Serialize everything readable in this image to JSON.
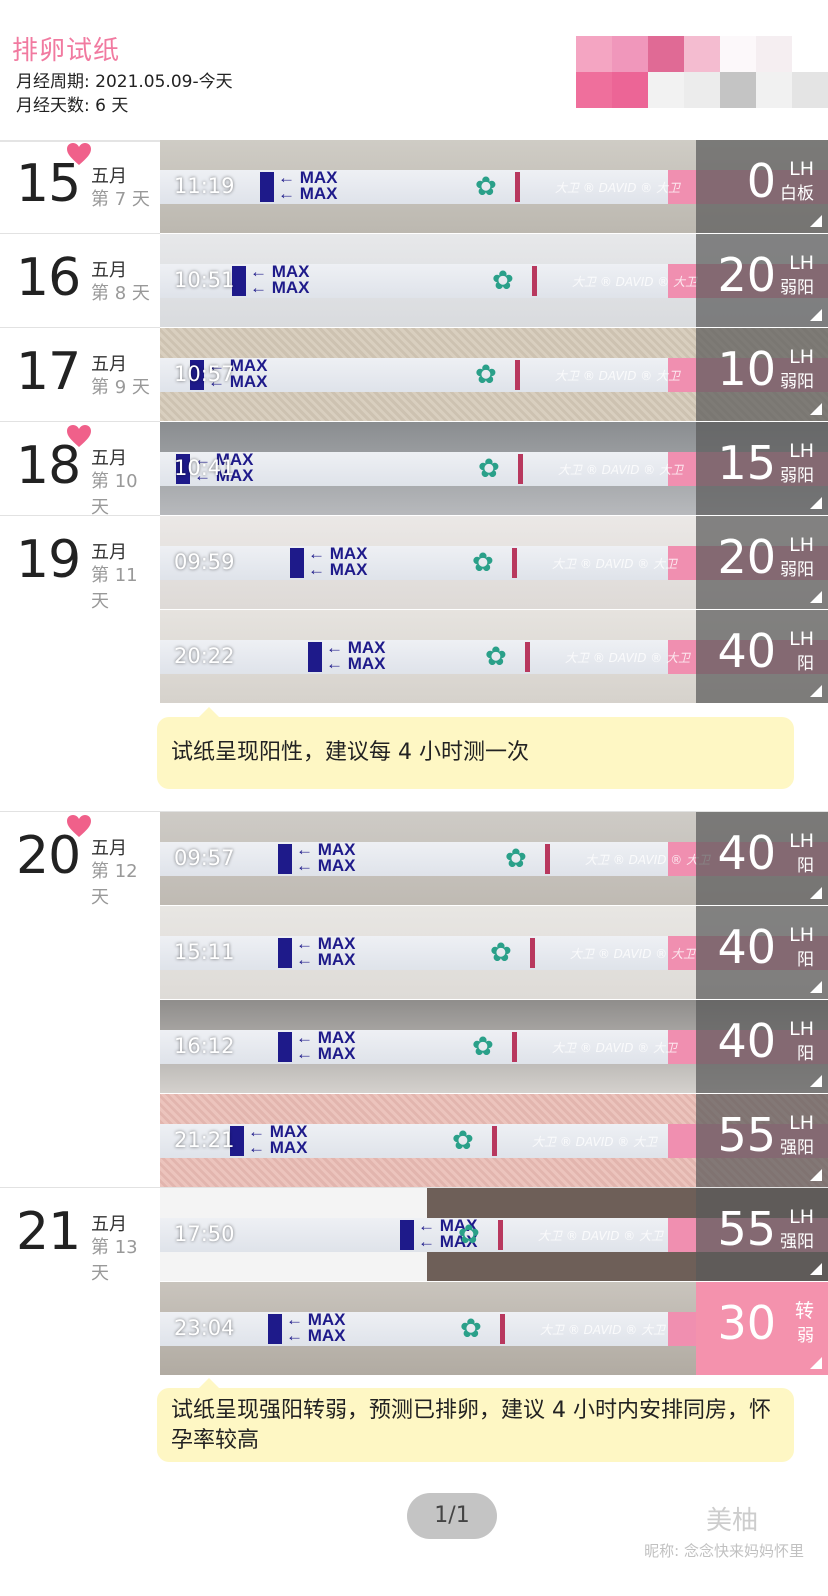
{
  "header": {
    "title": "排卵试纸",
    "cycle_line": "月经周期: 2021.05.09-今天",
    "days_line": "月经天数: 6 天"
  },
  "days": [
    {
      "num": "15",
      "month": "五月",
      "count": "第 7 天",
      "heart": true
    },
    {
      "num": "16",
      "month": "五月",
      "count": "第 8 天",
      "heart": false
    },
    {
      "num": "17",
      "month": "五月",
      "count": "第 9 天",
      "heart": false
    },
    {
      "num": "18",
      "month": "五月",
      "count": "第 10 天",
      "heart": true
    },
    {
      "num": "19",
      "month": "五月",
      "count": "第 11 天",
      "heart": false
    },
    {
      "num": "20",
      "month": "五月",
      "count": "第 12 天",
      "heart": true
    },
    {
      "num": "21",
      "month": "五月",
      "count": "第 13 天",
      "heart": false
    }
  ],
  "strips": [
    {
      "time": "11:19",
      "value": "0",
      "unit": "LH",
      "status": "白板",
      "highlight": false
    },
    {
      "time": "10:51",
      "value": "20",
      "unit": "LH",
      "status": "弱阳",
      "highlight": false
    },
    {
      "time": "10:57",
      "value": "10",
      "unit": "LH",
      "status": "弱阳",
      "highlight": false
    },
    {
      "time": "10:41",
      "value": "15",
      "unit": "LH",
      "status": "弱阳",
      "highlight": false
    },
    {
      "time": "09:59",
      "value": "20",
      "unit": "LH",
      "status": "弱阳",
      "highlight": false
    },
    {
      "time": "20:22",
      "value": "40",
      "unit": "LH",
      "status": "阳",
      "highlight": false
    },
    {
      "time": "09:57",
      "value": "40",
      "unit": "LH",
      "status": "阳",
      "highlight": false
    },
    {
      "time": "15:11",
      "value": "40",
      "unit": "LH",
      "status": "阳",
      "highlight": false
    },
    {
      "time": "16:12",
      "value": "40",
      "unit": "LH",
      "status": "阳",
      "highlight": false
    },
    {
      "time": "21:21",
      "value": "55",
      "unit": "LH",
      "status": "强阳",
      "highlight": false
    },
    {
      "time": "17:50",
      "value": "55",
      "unit": "LH",
      "status": "强阳",
      "highlight": false
    },
    {
      "time": "23:04",
      "value": "30",
      "unit": "转",
      "status": "弱",
      "highlight": true
    }
  ],
  "strip_labels": {
    "max": "MAX",
    "brand": "大卫 ® DAVID ® 大卫"
  },
  "tips": [
    {
      "text": "试纸呈现阳性，建议每 4 小时测一次"
    },
    {
      "text": "试纸呈现强阳转弱，预测已排卵，建议 4 小时内安排同房，怀孕率较高"
    }
  ],
  "footer": {
    "pager": "1/1",
    "watermark": "美柚",
    "nickname": "昵称: 念念快来妈妈怀里"
  },
  "colors": {
    "accent_pink": "#f17aa0",
    "heart": "#f0608a",
    "tip_bg": "#fef7c4",
    "lh_box": "#5a5a5a",
    "lh_box_highlight": "#f492ad",
    "control_line": "#b8385e"
  },
  "icons": {
    "heart": "heart-icon",
    "corner": "corner-triangle-icon"
  }
}
